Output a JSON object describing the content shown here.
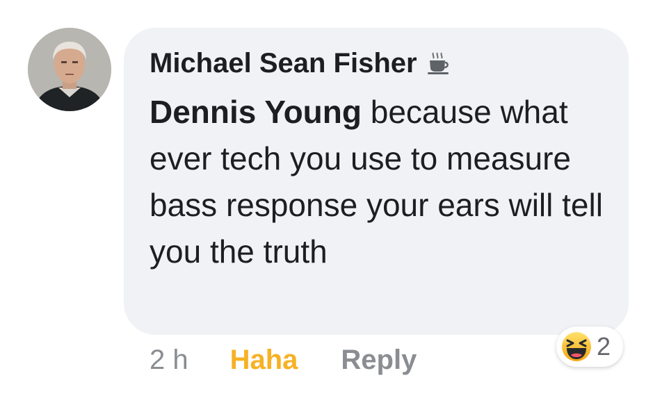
{
  "comment": {
    "author": "Michael Sean Fisher",
    "author_badge_icon": "coffee-cup-icon",
    "mention": "Dennis Young",
    "text": " because what ever tech you use to measure bass response your ears will tell you the truth"
  },
  "actions": {
    "time": "2 h",
    "reaction_label": "Haha",
    "reply_label": "Reply"
  },
  "reactions": {
    "icon": "haha-emoji-icon",
    "count": "2"
  },
  "colors": {
    "bubble_bg": "#f0f2f5",
    "haha_accent": "#f7b125",
    "muted_text": "#8a8d91"
  }
}
